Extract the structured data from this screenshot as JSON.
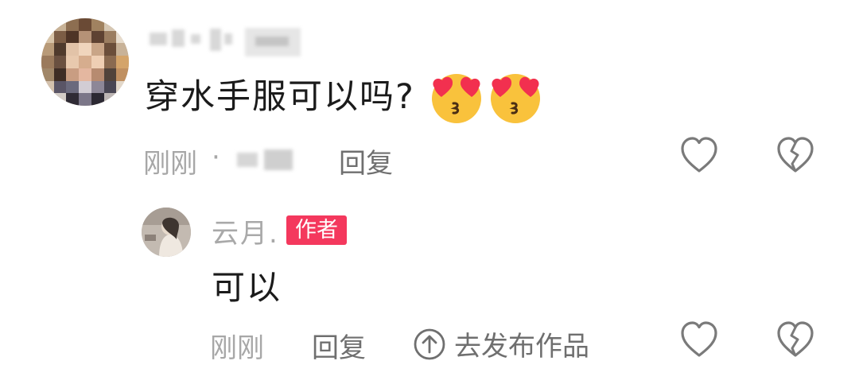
{
  "comment": {
    "text": "穿水手服可以吗?",
    "emojis": [
      "heart-eyes-kiss-emoji",
      "heart-eyes-kiss-emoji"
    ],
    "time": "刚刚",
    "separator": "·",
    "reply_label": "回复"
  },
  "reply": {
    "username": "云月.",
    "badge": "作者",
    "text": "可以",
    "time": "刚刚",
    "reply_label": "回复",
    "publish_label": "去发布作品"
  },
  "icons": {
    "like": "heart-outline-icon",
    "dislike": "broken-heart-icon",
    "publish": "arrow-up-circle-icon"
  },
  "colors": {
    "badge": "#f4385d",
    "meta_text": "#a7a7a7",
    "action_text": "#6f6f6f",
    "icon_stroke": "#7a7a7a",
    "emoji_face": "#f9c23c",
    "emoji_heart": "#f2304f"
  }
}
